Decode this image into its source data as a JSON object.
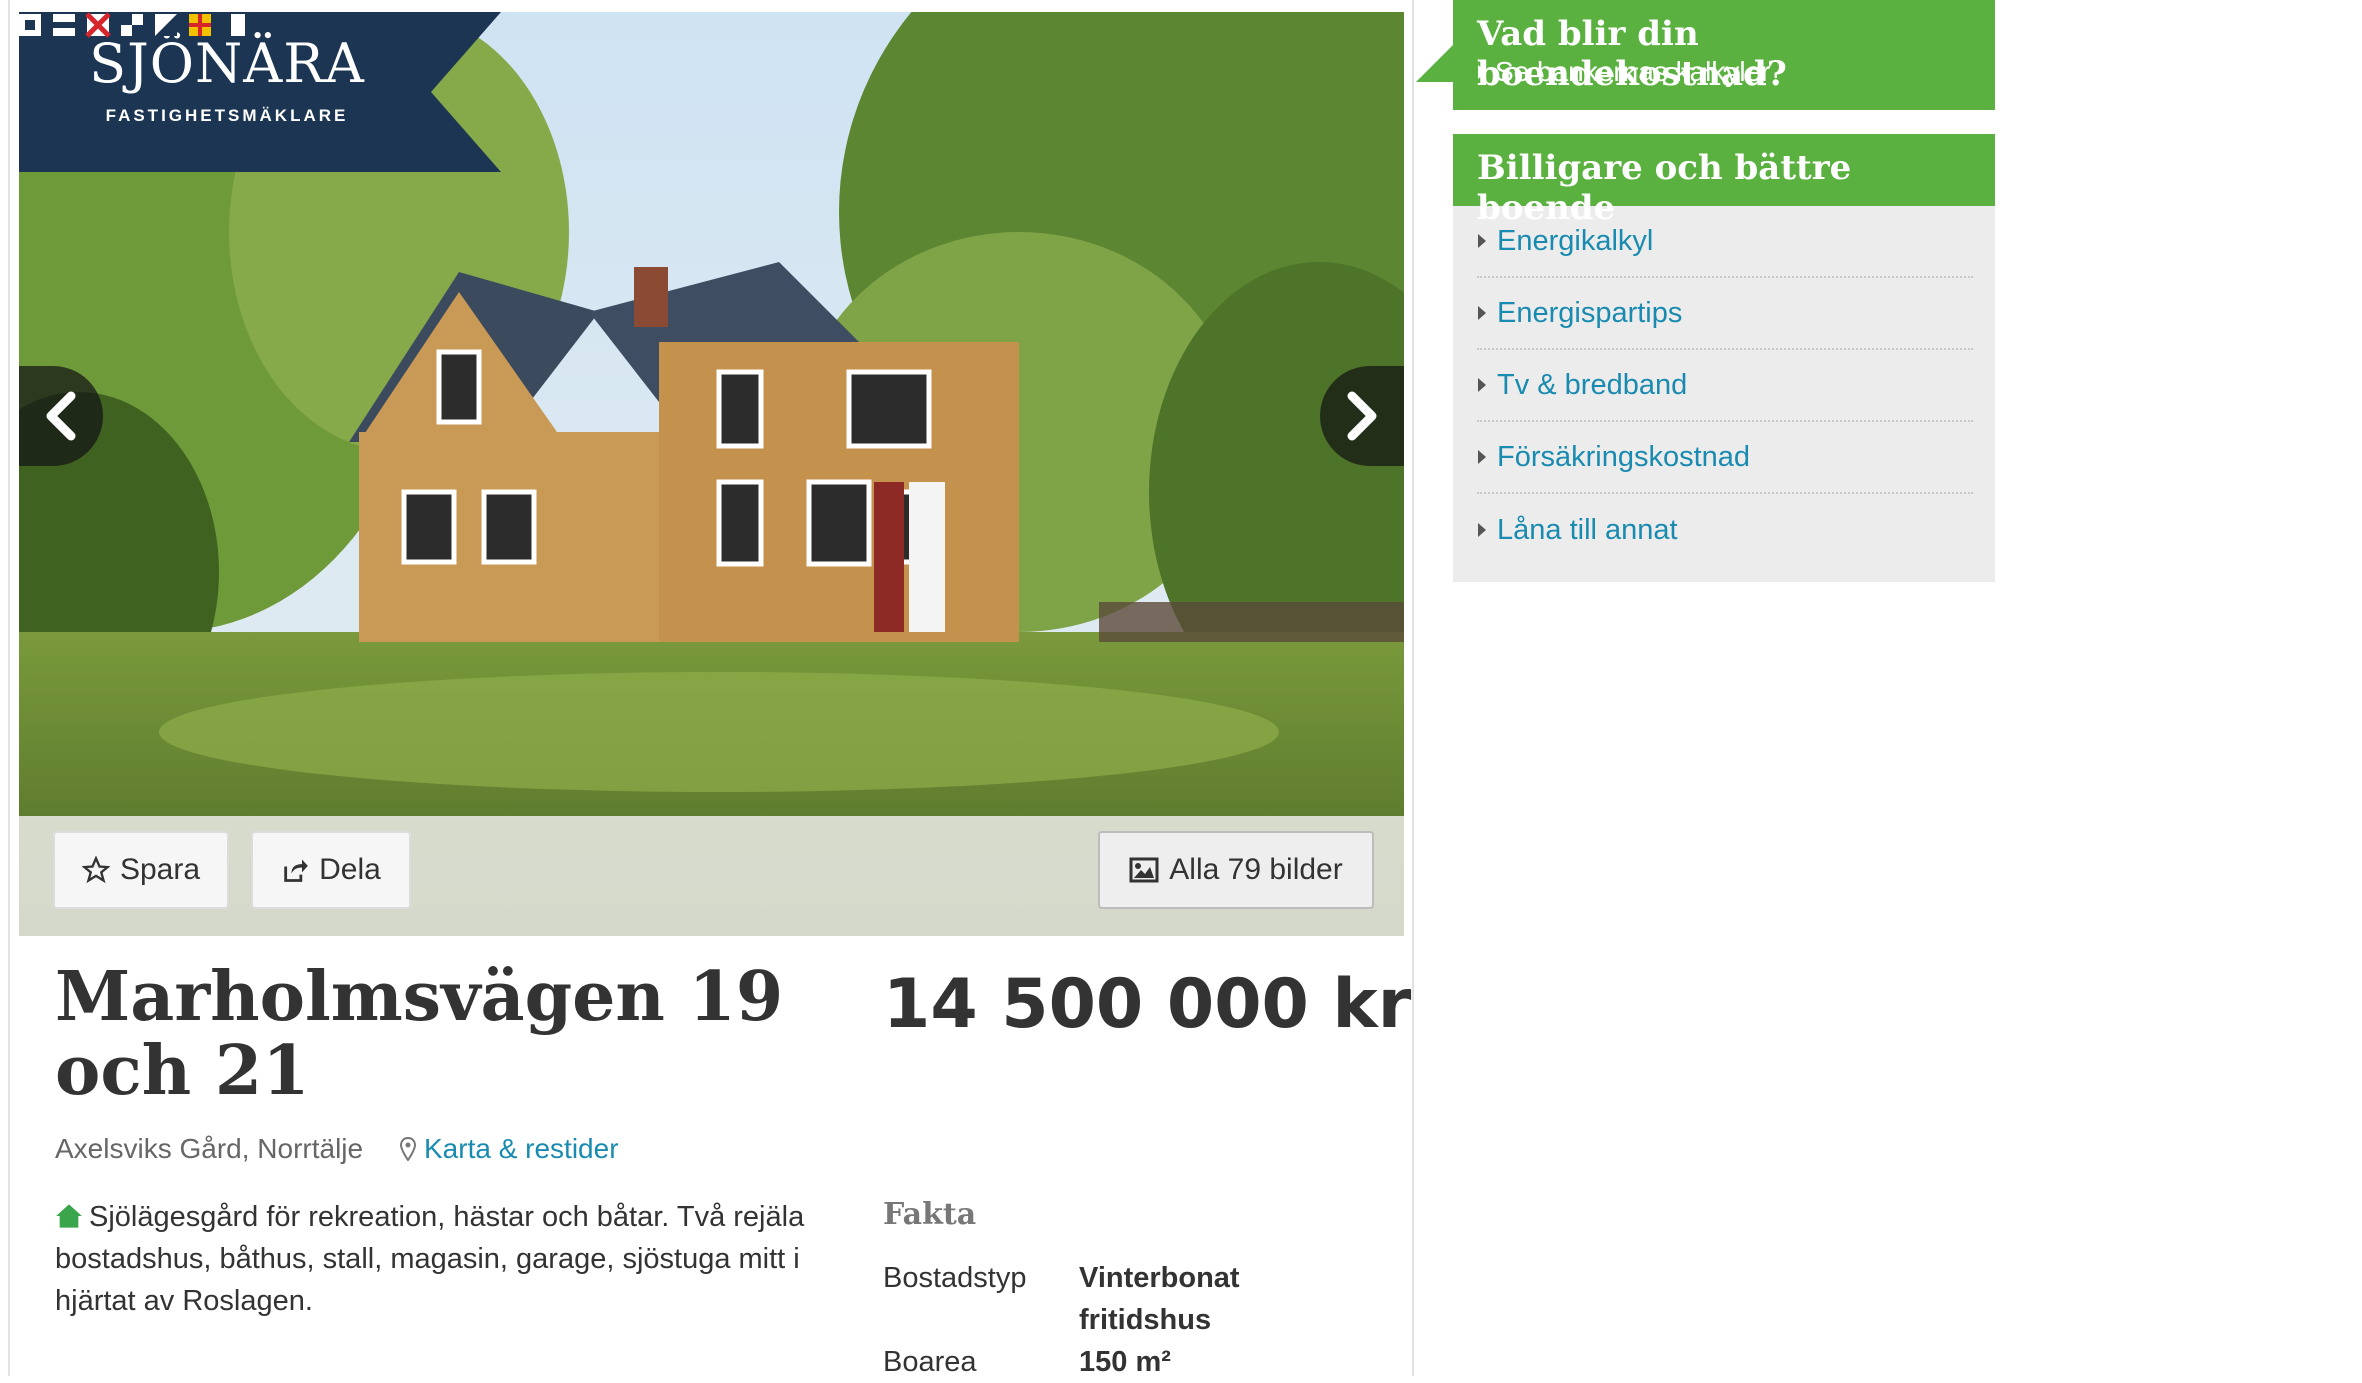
{
  "brand": {
    "name": "SJÖNÄRA",
    "subtitle": "FASTIGHETSMÄKLARE"
  },
  "gallery": {
    "save_label": "Spara",
    "share_label": "Dela",
    "all_images_label": "Alla 79 bilder"
  },
  "listing": {
    "title": "Marholmsvägen 19 och 21",
    "price": "14 500 000 kr",
    "area": "Axelsviks Gård, Norrtälje",
    "map_link": "Karta & restider",
    "description": "Sjölägesgård för rekreation, hästar och båtar. Två rejäla bostadshus, båthus, stall, magasin, garage, sjöstuga mitt i hjärtat av Roslagen."
  },
  "facts": {
    "heading": "Fakta",
    "rows": [
      {
        "key": "Bostadstyp",
        "value": "Vinterbonat fritidshus"
      },
      {
        "key": "Boarea",
        "value": "150 m²"
      }
    ]
  },
  "promo": {
    "title": "Vad blir din boendekostnad?",
    "link": "Se bankernas kalkyler"
  },
  "side_panel": {
    "title": "Billigare och bättre boende",
    "items": [
      {
        "label": "Energikalkyl"
      },
      {
        "label": "Energispartips"
      },
      {
        "label": "Tv & bredband"
      },
      {
        "label": "Försäkringskostnad"
      },
      {
        "label": "Låna till annat"
      }
    ]
  },
  "colors": {
    "accent_green": "#5bb140",
    "link_blue": "#1a8bb0",
    "brand_navy": "#1b3553"
  }
}
